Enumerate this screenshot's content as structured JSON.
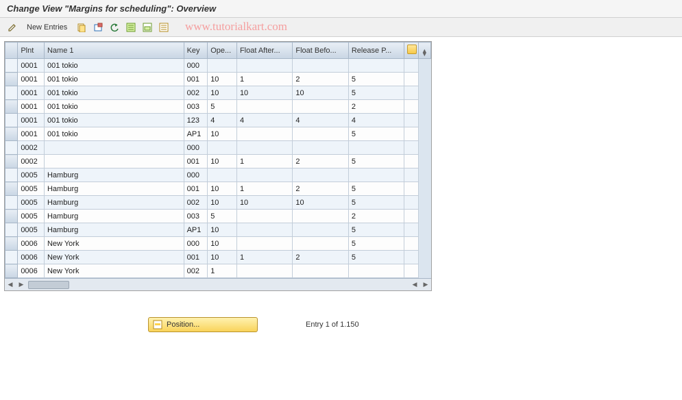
{
  "title": "Change View \"Margins for scheduling\": Overview",
  "watermark": "www.tutorialkart.com",
  "toolbar": {
    "new_entries": "New Entries"
  },
  "columns": {
    "plnt": "Plnt",
    "name": "Name 1",
    "key": "Key",
    "ope": "Ope...",
    "float_after": "Float After...",
    "float_before": "Float Befo...",
    "release_p": "Release P..."
  },
  "rows": [
    {
      "plnt": "0001",
      "name": "001 tokio",
      "key": "000",
      "ope": "",
      "fa": "",
      "fb": "",
      "rp": ""
    },
    {
      "plnt": "0001",
      "name": "001 tokio",
      "key": "001",
      "ope": "10",
      "fa": "1",
      "fb": "2",
      "rp": "5"
    },
    {
      "plnt": "0001",
      "name": "001 tokio",
      "key": "002",
      "ope": "10",
      "fa": "10",
      "fb": "10",
      "rp": "5"
    },
    {
      "plnt": "0001",
      "name": "001 tokio",
      "key": "003",
      "ope": "5",
      "fa": "",
      "fb": "",
      "rp": "2"
    },
    {
      "plnt": "0001",
      "name": "001 tokio",
      "key": "123",
      "ope": "4",
      "fa": "4",
      "fb": "4",
      "rp": "4"
    },
    {
      "plnt": "0001",
      "name": "001 tokio",
      "key": "AP1",
      "ope": "10",
      "fa": "",
      "fb": "",
      "rp": "5"
    },
    {
      "plnt": "0002",
      "name": "",
      "key": "000",
      "ope": "",
      "fa": "",
      "fb": "",
      "rp": ""
    },
    {
      "plnt": "0002",
      "name": "",
      "key": "001",
      "ope": "10",
      "fa": "1",
      "fb": "2",
      "rp": "5"
    },
    {
      "plnt": "0005",
      "name": "Hamburg",
      "key": "000",
      "ope": "",
      "fa": "",
      "fb": "",
      "rp": ""
    },
    {
      "plnt": "0005",
      "name": "Hamburg",
      "key": "001",
      "ope": "10",
      "fa": "1",
      "fb": "2",
      "rp": "5"
    },
    {
      "plnt": "0005",
      "name": "Hamburg",
      "key": "002",
      "ope": "10",
      "fa": "10",
      "fb": "10",
      "rp": "5"
    },
    {
      "plnt": "0005",
      "name": "Hamburg",
      "key": "003",
      "ope": "5",
      "fa": "",
      "fb": "",
      "rp": "2"
    },
    {
      "plnt": "0005",
      "name": "Hamburg",
      "key": "AP1",
      "ope": "10",
      "fa": "",
      "fb": "",
      "rp": "5"
    },
    {
      "plnt": "0006",
      "name": "New York",
      "key": "000",
      "ope": "10",
      "fa": "",
      "fb": "",
      "rp": "5"
    },
    {
      "plnt": "0006",
      "name": "New York",
      "key": "001",
      "ope": "10",
      "fa": "1",
      "fb": "2",
      "rp": "5"
    },
    {
      "plnt": "0006",
      "name": "New York",
      "key": "002",
      "ope": "1",
      "fa": "",
      "fb": "",
      "rp": ""
    }
  ],
  "footer": {
    "position_label": "Position...",
    "entry_status": "Entry 1 of 1.150"
  }
}
